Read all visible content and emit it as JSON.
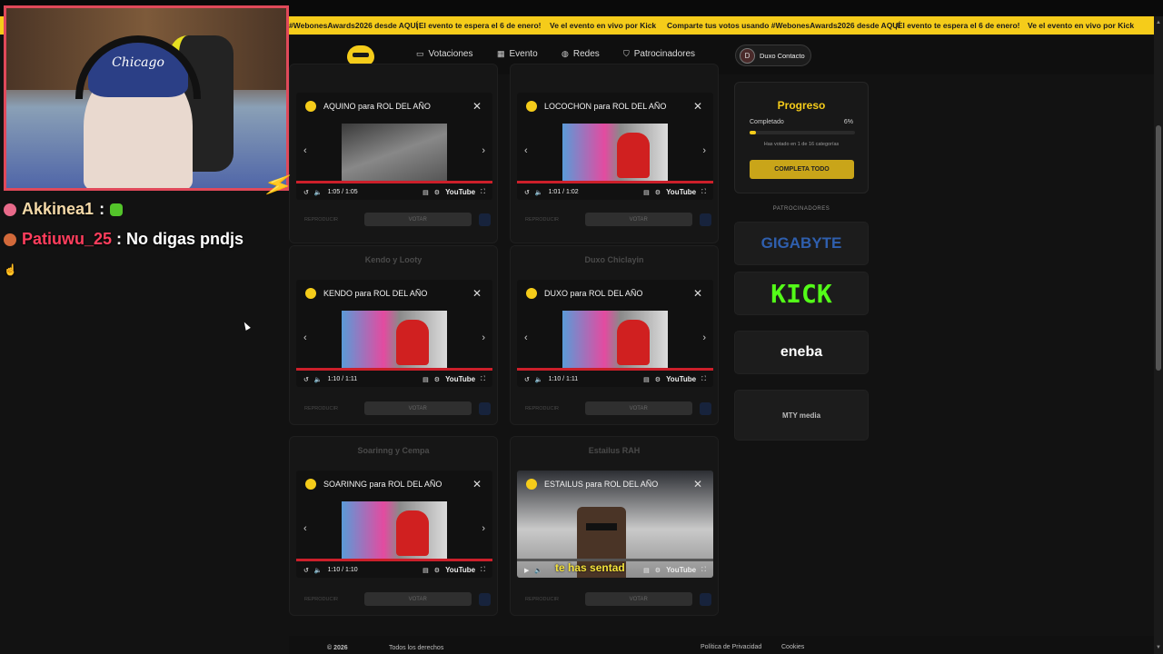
{
  "ticker": [
    "#WebonesAwards2026 desde AQUÍ",
    "¡El evento te espera el 6 de enero!",
    "Ve el evento en vivo por Kick",
    "Comparte tus votos usando #WebonesAwards2026 desde AQUÍ",
    "¡El evento te espera el 6 de enero!",
    "Ve el evento en vivo por Kick"
  ],
  "nav": {
    "votaciones": "Votaciones",
    "evento": "Evento",
    "redes": "Redes",
    "patrocinadores": "Patrocinadores",
    "contact_initial": "D",
    "contact_label": "Duxo Contacto"
  },
  "chat": [
    {
      "user": "Akkinea1",
      "sep": " :",
      "msg": "",
      "user_color": "#f4d9a8"
    },
    {
      "user": "Patiuwu_25",
      "sep": " :",
      "msg": " No digas pndjs",
      "user_color": "#ff3e5d"
    }
  ],
  "cards": [
    {
      "title": "",
      "video_title": "AQUINO para ROL DEL AÑO",
      "time": "1:05 / 1:05",
      "repro": "REPRODUCIR",
      "vote": "VOTAR"
    },
    {
      "title": "",
      "video_title": "LOCOCHON para ROL DEL AÑO",
      "time": "1:01 / 1:02",
      "repro": "REPRODUCIR",
      "vote": "VOTAR"
    },
    {
      "title": "Kendo y Looty",
      "video_title": "KENDO para ROL DEL AÑO",
      "time": "1:10 / 1:11",
      "repro": "REPRODUCIR",
      "vote": "VOTAR"
    },
    {
      "title": "Duxo Chiclayin",
      "video_title": "DUXO para ROL DEL AÑO",
      "time": "1:10 / 1:11",
      "repro": "REPRODUCIR",
      "vote": "VOTAR"
    },
    {
      "title": "Soarinng y Cempa",
      "video_title": "SOARINNG para ROL DEL AÑO",
      "time": "1:10 / 1:10",
      "repro": "REPRODUCIR",
      "vote": "VOTAR"
    },
    {
      "title": "Estailus RAH",
      "video_title": "ESTAILUS para ROL DEL AÑO",
      "time": "",
      "subtitle": "te has sentad",
      "repro": "REPRODUCIR",
      "vote": "VOTAR"
    }
  ],
  "youtube_label": "YouTube",
  "progress": {
    "title": "Progreso",
    "label": "Completado",
    "percent": 6,
    "percent_text": "6%",
    "note": "Has votado en 1 de 16 categorías",
    "button": "COMPLETA TODO"
  },
  "sponsors": {
    "title": "PATROCINADORES",
    "items": [
      {
        "name": "GIGABYTE",
        "color": "#2f5fae"
      },
      {
        "name": "KICK",
        "color": "#53fc18"
      },
      {
        "name": "eneba",
        "color": "#ffffff"
      },
      {
        "name": "MTY media",
        "color": "#bbbbbb"
      }
    ]
  },
  "footer": {
    "copyright": "© 2026",
    "rights": "Todos los derechos",
    "privacy": "Política de Privacidad",
    "cookies": "Cookies"
  },
  "colors": {
    "accent": "#f5cc1a",
    "cam_border": "#e0495a"
  }
}
